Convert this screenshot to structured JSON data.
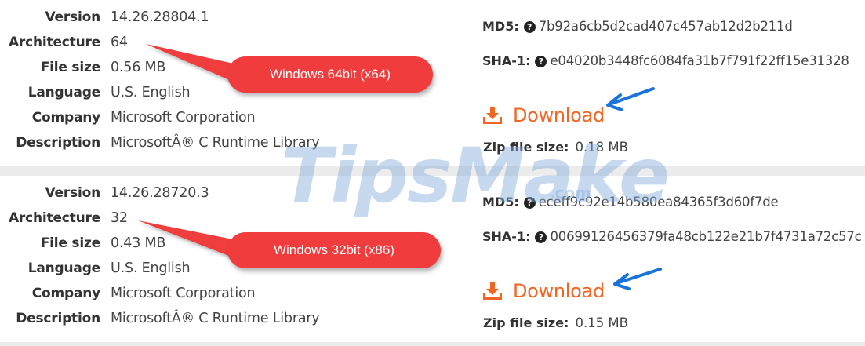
{
  "files": [
    {
      "info": [
        {
          "label": "Version",
          "value": "14.26.28804.1"
        },
        {
          "label": "Architecture",
          "value": "64"
        },
        {
          "label": "File size",
          "value": "0.56 MB"
        },
        {
          "label": "Language",
          "value": "U.S. English"
        },
        {
          "label": "Company",
          "value": "Microsoft Corporation"
        },
        {
          "label": "Description",
          "value": "MicrosoftÂ® C Runtime Library"
        }
      ],
      "md5_label": "MD5:",
      "md5": "7b92a6cb5d2cad407c457ab12d2b211d",
      "sha1_label": "SHA-1:",
      "sha1": "e04020b3448fc6084fa31b7f791f22ff15e31328",
      "download_label": "Download",
      "zip_label": "Zip file size:",
      "zip_size": "0.18 MB",
      "callout": "Windows 64bit (x64)"
    },
    {
      "info": [
        {
          "label": "Version",
          "value": "14.26.28720.3"
        },
        {
          "label": "Architecture",
          "value": "32"
        },
        {
          "label": "File size",
          "value": "0.43 MB"
        },
        {
          "label": "Language",
          "value": "U.S. English"
        },
        {
          "label": "Company",
          "value": "Microsoft Corporation"
        },
        {
          "label": "Description",
          "value": "MicrosoftÂ® C Runtime Library"
        }
      ],
      "md5_label": "MD5:",
      "md5": "eceff9c92e14b580ea84365f3d60f7de",
      "sha1_label": "SHA-1:",
      "sha1": "00699126456379fa48cb122e21b7f4731a72c57c",
      "download_label": "Download",
      "zip_label": "Zip file size:",
      "zip_size": "0.15 MB",
      "callout": "Windows 32bit (x86)"
    }
  ],
  "help_glyph": "?",
  "watermark": {
    "main": "TipsMake",
    "sub": ".com"
  },
  "icons": {
    "download": "download-tray-icon",
    "help": "question-circle-icon",
    "arrow": "arrow-pointer-icon"
  },
  "colors": {
    "download": "#f26522",
    "callout": "#f03c3c",
    "arrow": "#1a73d9"
  }
}
